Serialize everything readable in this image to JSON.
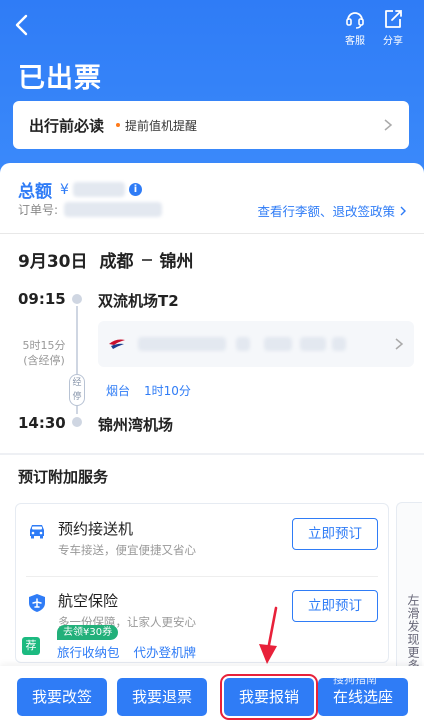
{
  "header": {
    "title": "已出票",
    "service_label": "客服",
    "share_label": "分享"
  },
  "notice": {
    "title": "出行前必读",
    "tip": "提前值机提醒"
  },
  "order": {
    "total_label": "总额",
    "currency": "¥",
    "order_no_label": "订单号:",
    "policy_link": "查看行李额、退改签政策"
  },
  "trip": {
    "date": "9月30日",
    "from_city": "成都",
    "to_city": "锦州",
    "depart_time": "09:15",
    "depart_airport": "双流机场T2",
    "duration": "5时15分",
    "duration_note": "(含经停)",
    "stop_badge": "经停",
    "stop_city": "烟台",
    "stop_duration": "1时10分",
    "arrive_time": "14:30",
    "arrive_airport": "锦州湾机场"
  },
  "services": {
    "title": "预订附加服务",
    "items": [
      {
        "name": "预约接送机",
        "desc": "专车接送，便宜便捷又省心",
        "button": "立即预订"
      },
      {
        "name": "航空保险",
        "desc": "多一份保障，让家人更安心",
        "button": "立即预订"
      }
    ],
    "promo_tag": "荐",
    "coupon": "去领¥30券",
    "promo_links": [
      "旅行收纳包",
      "代办登机牌"
    ],
    "side_more": "左滑发现更多"
  },
  "bottom_actions": [
    {
      "label": "我要改签"
    },
    {
      "label": "我要退票"
    },
    {
      "label": "我要报销"
    },
    {
      "label": "在线选座"
    }
  ],
  "watermark": "搜狗指南",
  "colors": {
    "primary": "#2f7cf6",
    "highlight": "#e8213a",
    "promo": "#22b07a"
  }
}
